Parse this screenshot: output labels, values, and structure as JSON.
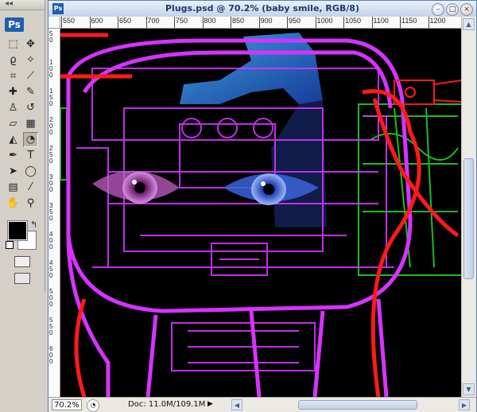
{
  "app": {
    "logo": "Ps"
  },
  "document": {
    "title": "Plugs.psd @ 70.2% (baby smile, RGB/8)",
    "zoom": "70.2%",
    "doc_size": "Doc: 11.0M/109.1M"
  },
  "rulers": {
    "horizontal": [
      "550",
      "600",
      "650",
      "700",
      "750",
      "800",
      "850",
      "900",
      "950",
      "1000",
      "1050",
      "1100",
      "1150",
      "1200"
    ],
    "vertical": [
      "50",
      "100",
      "150",
      "200",
      "250",
      "300",
      "350",
      "400",
      "450",
      "500",
      "550",
      "600"
    ]
  },
  "tools": [
    {
      "name": "marquee-tool",
      "glyph": "⬚"
    },
    {
      "name": "move-tool",
      "glyph": "✥"
    },
    {
      "name": "lasso-tool",
      "glyph": "ϱ"
    },
    {
      "name": "magic-wand-tool",
      "glyph": "✧"
    },
    {
      "name": "crop-tool",
      "glyph": "⌗"
    },
    {
      "name": "slice-tool",
      "glyph": "⟋"
    },
    {
      "name": "healing-brush-tool",
      "glyph": "✚"
    },
    {
      "name": "brush-tool",
      "glyph": "✎"
    },
    {
      "name": "clone-stamp-tool",
      "glyph": "♙"
    },
    {
      "name": "history-brush-tool",
      "glyph": "↺"
    },
    {
      "name": "eraser-tool",
      "glyph": "▱"
    },
    {
      "name": "gradient-tool",
      "glyph": "▦"
    },
    {
      "name": "blur-tool",
      "glyph": "◭"
    },
    {
      "name": "dodge-tool",
      "glyph": "◔"
    },
    {
      "name": "pen-tool",
      "glyph": "✒"
    },
    {
      "name": "type-tool",
      "glyph": "T"
    },
    {
      "name": "path-selection-tool",
      "glyph": "➤"
    },
    {
      "name": "shape-tool",
      "glyph": "◯"
    },
    {
      "name": "notes-tool",
      "glyph": "▤"
    },
    {
      "name": "eyedropper-tool",
      "glyph": "⁄"
    },
    {
      "name": "hand-tool",
      "glyph": "✋"
    },
    {
      "name": "zoom-tool",
      "glyph": "⚲"
    }
  ],
  "colors": {
    "foreground": "#000000",
    "background": "#ffffff",
    "magenta": "#d633ff",
    "red": "#ff1a1a",
    "green": "#22dd22",
    "blue": "#3a7bff"
  }
}
